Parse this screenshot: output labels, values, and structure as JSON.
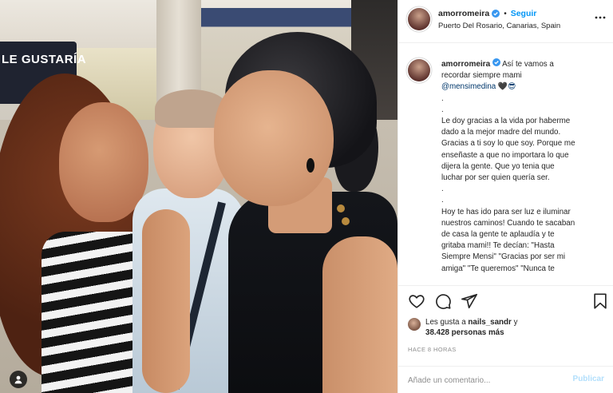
{
  "photo": {
    "sign_text": "LE GUSTARÍA",
    "tag_icon": "person-icon"
  },
  "header": {
    "username": "amorromeira",
    "separator": "•",
    "follow_label": "Seguir",
    "location": "Puerto Del Rosario, Canarias, Spain",
    "more_icon": "more-horizontal-icon"
  },
  "caption": {
    "username": "amorromeira",
    "lines": [
      "Así te vamos a",
      "recordar siempre mami",
      "@mensimedina 🖤😎",
      ".",
      ".",
      "Le doy gracias a la vida por haberme",
      "dado a la mejor madre del mundo.",
      "Gracias a ti soy lo que soy. Porque me",
      "enseñaste a que no importara lo que",
      "dijera la gente. Que yo tenia que",
      "luchar por ser quien quería ser.",
      ".",
      ".",
      "Hoy te has ido para ser luz e iluminar",
      "nuestros caminos! Cuando te sacaban",
      "de casa la gente te aplaudía y te",
      "gritaba mami!! Te decían: \"Hasta",
      "Siempre Mensi\" \"Gracias por ser mi",
      "amiga\" \"Te queremos\" \"Nunca te"
    ]
  },
  "likes": {
    "prefix": "Les gusta a",
    "user": "nails_sandr",
    "suffix": "y",
    "count": "38.428 personas más"
  },
  "timestamp": "HACE 8 HORAS",
  "comment": {
    "placeholder": "Añade un comentario...",
    "publish_label": "Publicar"
  },
  "colors": {
    "link_blue": "#0095f6",
    "publish_disabled": "#b2dffc",
    "verified_blue": "#3897f0"
  }
}
